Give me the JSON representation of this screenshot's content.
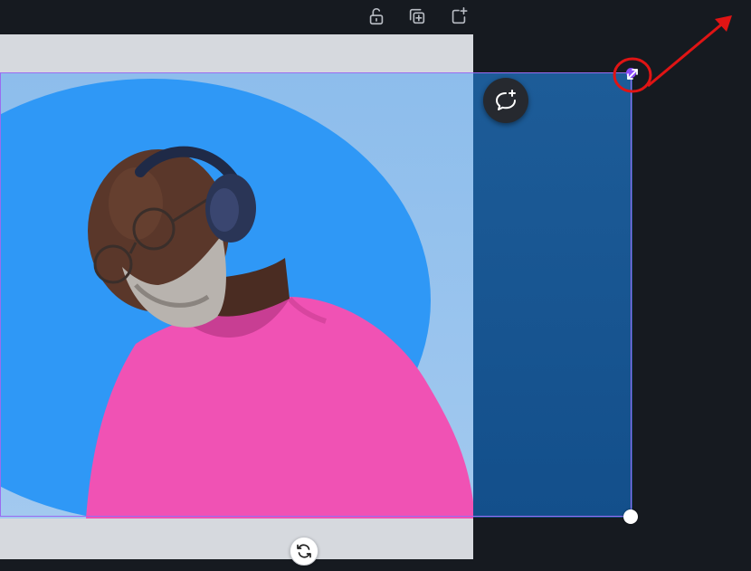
{
  "toolbar": {
    "icons": [
      "unlock-icon",
      "duplicate-page-icon",
      "add-page-icon"
    ]
  },
  "canvas": {
    "page_background": "#d6d9de",
    "workspace_background": "#161a20",
    "selection_color": "#9a6cf0",
    "overflow_tint": "#1d5c98"
  },
  "image": {
    "subject": "man-in-pink-tshirt-with-headphones",
    "circle_color": "#2f98f6",
    "tshirt_color": "#f052b4"
  },
  "controls": {
    "comment_icon": "add-comment-icon",
    "resize_icon": "diagonal-resize-icon",
    "rotate_icon": "rotate-icon"
  },
  "annotation": {
    "highlight_color": "#e01414",
    "shape": "circle-with-arrow"
  }
}
